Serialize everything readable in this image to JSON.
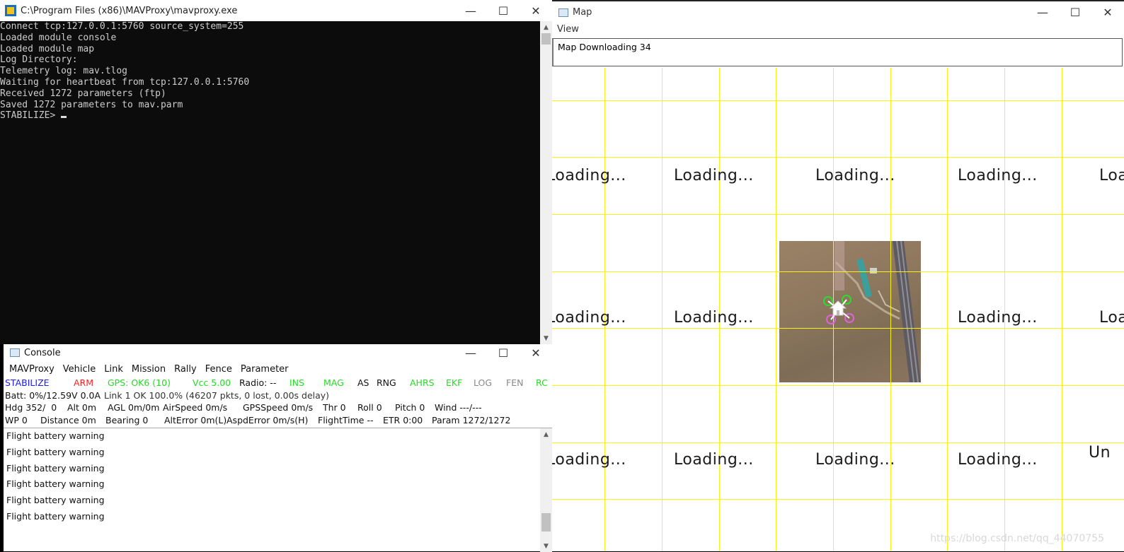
{
  "terminal": {
    "title": "C:\\Program Files (x86)\\MAVProxy\\mavproxy.exe",
    "lines": [
      "Connect tcp:127.0.0.1:5760 source_system=255",
      "Loaded module console",
      "Loaded module map",
      "Log Directory:",
      "Telemetry log: mav.tlog",
      "Waiting for heartbeat from tcp:127.0.0.1:5760",
      "Received 1272 parameters (ftp)",
      "Saved 1272 parameters to mav.parm"
    ],
    "prompt": "STABILIZE>"
  },
  "console": {
    "title": "Console",
    "menu": [
      "MAVProxy",
      "Vehicle",
      "Link",
      "Mission",
      "Rally",
      "Fence",
      "Parameter"
    ],
    "status_rows": [
      [
        {
          "text": "STABILIZE",
          "color": "#1a1aff"
        },
        {
          "text": "ARM",
          "color": "#ff2020"
        },
        {
          "text": "GPS: OK6 (10)",
          "color": "#22dd22"
        },
        {
          "text": "Vcc 5.00",
          "color": "#22dd22"
        },
        {
          "text": "Radio: --",
          "color": "#111111"
        },
        {
          "text": "INS",
          "color": "#22dd22"
        },
        {
          "text": "MAG",
          "color": "#22dd22"
        },
        {
          "text": "AS",
          "color": "#111111"
        },
        {
          "text": "RNG",
          "color": "#111111"
        },
        {
          "text": "AHRS",
          "color": "#22dd22"
        },
        {
          "text": "EKF",
          "color": "#22dd22"
        },
        {
          "text": "LOG",
          "color": "#888888"
        },
        {
          "text": "FEN",
          "color": "#888888"
        },
        {
          "text": "RC",
          "color": "#22dd22"
        }
      ],
      [
        {
          "text": "Batt: 0%/12.59V 0.0A",
          "color": "#111111"
        },
        {
          "text": "Link 1 OK 100.0% (46207 pkts, 0 lost, 0.00s delay)",
          "color": "#333333"
        }
      ],
      [
        {
          "text": "Hdg 352/  0",
          "color": "#111111"
        },
        {
          "text": "Alt 0m",
          "color": "#111111"
        },
        {
          "text": "AGL 0m/0m",
          "color": "#111111"
        },
        {
          "text": "AirSpeed 0m/s",
          "color": "#111111"
        },
        {
          "text": "GPSSpeed 0m/s",
          "color": "#111111"
        },
        {
          "text": "Thr 0",
          "color": "#111111"
        },
        {
          "text": "Roll 0",
          "color": "#111111"
        },
        {
          "text": "Pitch 0",
          "color": "#111111"
        },
        {
          "text": "Wind ---/---",
          "color": "#111111"
        }
      ],
      [
        {
          "text": "WP 0",
          "color": "#111111"
        },
        {
          "text": "Distance 0m",
          "color": "#111111"
        },
        {
          "text": "Bearing 0",
          "color": "#111111"
        },
        {
          "text": "AltError 0m(L)",
          "color": "#111111"
        },
        {
          "text": "AspdError 0m/s(H)",
          "color": "#111111"
        },
        {
          "text": "FlightTime --",
          "color": "#111111"
        },
        {
          "text": "ETR 0:00",
          "color": "#111111"
        },
        {
          "text": "Param 1272/1272",
          "color": "#111111"
        }
      ]
    ],
    "messages": [
      "Flight battery warning",
      "Flight battery warning",
      "Flight battery warning",
      "Flight battery warning",
      "Flight battery warning",
      "Flight battery warning"
    ]
  },
  "map": {
    "title": "Map",
    "menu": [
      "View"
    ],
    "status": "Map Downloading 34",
    "tile_loading_text": "Loading...",
    "tile_unavailable_text": "Un",
    "grid_color": "#f7f21a",
    "icons": [
      "home-icon",
      "quad-vehicle-icon"
    ]
  },
  "watermark": "https://blog.csdn.net/qq_44070755"
}
